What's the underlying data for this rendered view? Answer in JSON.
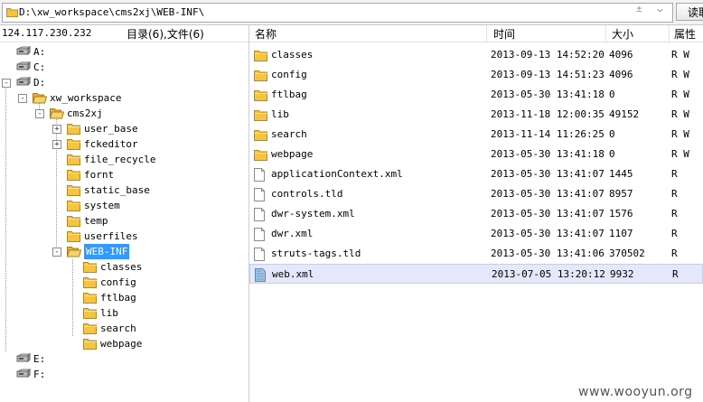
{
  "pathbar": {
    "path": "D:\\xw_workspace\\cms2xj\\WEB-INF\\",
    "dropdown_symbol": "±",
    "chevron": "⌵",
    "read_button": "读取"
  },
  "header": {
    "ip": "124.117.230.232",
    "dir_count": "目录(6),文件(6)",
    "columns": {
      "name": "名称",
      "time": "时间",
      "size": "大小",
      "attr": "属性"
    }
  },
  "tree": [
    {
      "label": "A:",
      "icon": "drive-icon"
    },
    {
      "label": "C:",
      "icon": "drive-icon"
    },
    {
      "label": "D:",
      "icon": "drive-icon"
    },
    {
      "label": "xw_workspace",
      "icon": "folder-open-icon"
    },
    {
      "label": "cms2xj",
      "icon": "folder-open-icon"
    },
    {
      "label": "user_base",
      "icon": "folder-icon"
    },
    {
      "label": "fckeditor",
      "icon": "folder-icon"
    },
    {
      "label": "file_recycle",
      "icon": "folder-icon"
    },
    {
      "label": "fornt",
      "icon": "folder-icon"
    },
    {
      "label": "static_base",
      "icon": "folder-icon"
    },
    {
      "label": "system",
      "icon": "folder-icon"
    },
    {
      "label": "temp",
      "icon": "folder-icon"
    },
    {
      "label": "userfiles",
      "icon": "folder-icon"
    },
    {
      "label": "WEB-INF",
      "icon": "folder-open-icon"
    },
    {
      "label": "classes",
      "icon": "folder-icon"
    },
    {
      "label": "config",
      "icon": "folder-icon"
    },
    {
      "label": "ftlbag",
      "icon": "folder-icon"
    },
    {
      "label": "lib",
      "icon": "folder-icon"
    },
    {
      "label": "search",
      "icon": "folder-icon"
    },
    {
      "label": "webpage",
      "icon": "folder-icon"
    },
    {
      "label": "E:",
      "icon": "drive-icon"
    },
    {
      "label": "F:",
      "icon": "drive-icon"
    }
  ],
  "files": [
    {
      "name": "classes",
      "time": "2013-09-13 14:52:20",
      "size": "4096",
      "attr": "R W",
      "icon": "folder-icon"
    },
    {
      "name": "config",
      "time": "2013-09-13 14:51:23",
      "size": "4096",
      "attr": "R W",
      "icon": "folder-icon"
    },
    {
      "name": "ftlbag",
      "time": "2013-05-30 13:41:18",
      "size": "0",
      "attr": "R W",
      "icon": "folder-icon"
    },
    {
      "name": "lib",
      "time": "2013-11-18 12:00:35",
      "size": "49152",
      "attr": "R W",
      "icon": "folder-icon"
    },
    {
      "name": "search",
      "time": "2013-11-14 11:26:25",
      "size": "0",
      "attr": "R W",
      "icon": "folder-icon"
    },
    {
      "name": "webpage",
      "time": "2013-05-30 13:41:18",
      "size": "0",
      "attr": "R W",
      "icon": "folder-icon"
    },
    {
      "name": "applicationContext.xml",
      "time": "2013-05-30 13:41:07",
      "size": "1445",
      "attr": "R",
      "icon": "file-icon"
    },
    {
      "name": "controls.tld",
      "time": "2013-05-30 13:41:07",
      "size": "8957",
      "attr": "R",
      "icon": "file-icon"
    },
    {
      "name": "dwr-system.xml",
      "time": "2013-05-30 13:41:07",
      "size": "1576",
      "attr": "R",
      "icon": "file-icon"
    },
    {
      "name": "dwr.xml",
      "time": "2013-05-30 13:41:07",
      "size": "1107",
      "attr": "R",
      "icon": "file-icon"
    },
    {
      "name": "struts-tags.tld",
      "time": "2013-05-30 13:41:06",
      "size": "370502",
      "attr": "R",
      "icon": "file-icon"
    },
    {
      "name": "web.xml",
      "time": "2013-07-05 13:20:12",
      "size": "9932",
      "attr": "R",
      "icon": "file-selected-icon"
    }
  ],
  "watermark": "www.wooyun.org",
  "colors": {
    "selection": "#3399ff",
    "row_highlight": "#e5e7fb",
    "folder": "#f5c542"
  }
}
